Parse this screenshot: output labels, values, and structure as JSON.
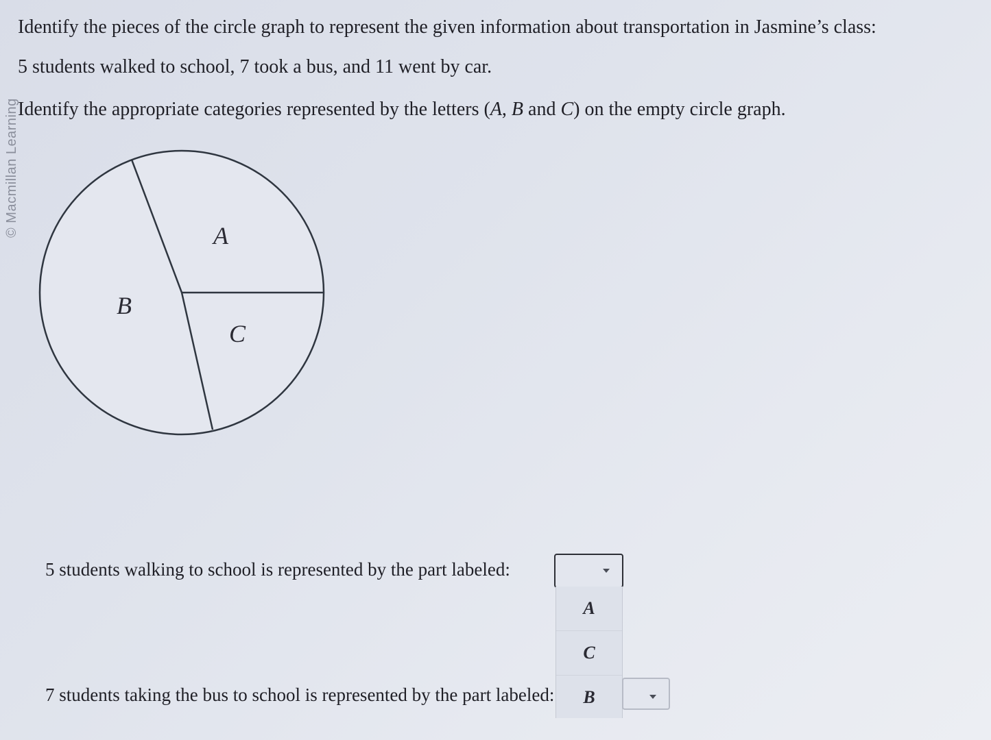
{
  "watermark": "© Macmillan Learning",
  "question": {
    "line1": "Identify the pieces of the circle graph to represent the given information about transportation in Jasmine’s class:",
    "line2": "5 students walked to school, 7 took a bus, and 11 went by car.",
    "line3_before": "Identify the appropriate categories represented by the letters (",
    "line3_a": "A",
    "line3_sep": ", ",
    "line3_b": "B",
    "line3_and": " and ",
    "line3_c": "C",
    "line3_after": ") on the empty circle graph."
  },
  "pie": {
    "labels": [
      "A",
      "B",
      "C"
    ]
  },
  "answers": [
    {
      "prompt": "5 students walking to school is represented by the part labeled:",
      "selected": ""
    },
    {
      "prompt": "7 students taking the bus to school is represented by the part labeled:",
      "selected": ""
    }
  ],
  "dropdown": {
    "options": [
      "A",
      "C",
      "B"
    ]
  },
  "colors": {
    "pie_stroke": "#2f3640",
    "pie_fill": "#e4e7ef"
  }
}
